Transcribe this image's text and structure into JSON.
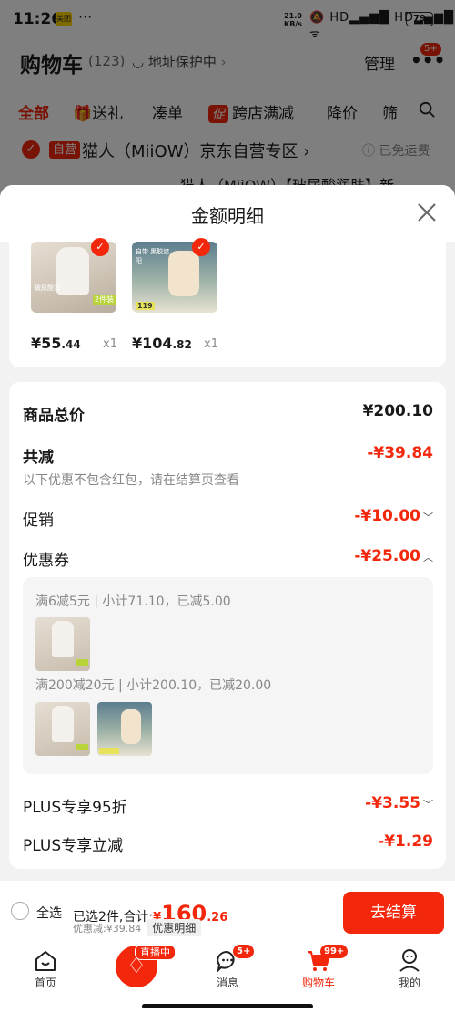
{
  "status_bar": {
    "time": "11:26",
    "app_badge": "美团",
    "more": "···",
    "net_speed_value": "21.0",
    "net_speed_unit": "KB/s",
    "signal_icons": "🔕 HD▂▄▆█ HD▂▄▆█ ᯤ",
    "battery": "79"
  },
  "cart_header": {
    "title": "购物车",
    "count": "(123)",
    "address_guard": "地址保护中",
    "manage": "管理",
    "message_badge": "5+"
  },
  "filter_tabs": {
    "all": "全部",
    "gift": "送礼",
    "bundle": "凑单",
    "promo_tag": "促",
    "cross_store": "跨店满减",
    "price_drop": "降价",
    "filter": "筛"
  },
  "store_row": {
    "self_run_tag": "自营",
    "store_name": "猫人（MiiOW）京东自营专区",
    "free_shipping": "已免运费"
  },
  "product_peek": "猫人（MiiOW）【玻尿酸润肤】新",
  "sheet": {
    "title": "金额明细",
    "items": [
      {
        "img_text_a": "玻尿酸润",
        "img_text_b": "2件装",
        "price_int": "¥55",
        "price_dec": ".44",
        "qty": "x1"
      },
      {
        "img_text_a": "自带 黑胶遮阳",
        "img_text_b": "119",
        "price_int": "¥104",
        "price_dec": ".82",
        "qty": "x1"
      }
    ],
    "total_label": "商品总价",
    "total_value": "¥200.10",
    "reduced_label": "共减",
    "reduced_value": "-¥39.84",
    "reduced_note": "以下优惠不包含红包，请在结算页查看",
    "promo_label": "促销",
    "promo_value": "-¥10.00",
    "coupon_label": "优惠券",
    "coupon_value": "-¥25.00",
    "coupon_rules": [
      "满6减5元 | 小计71.10，已减5.00",
      "满200减20元 | 小计200.10，已减20.00"
    ],
    "plus95_label": "PLUS专享95折",
    "plus95_value": "-¥3.55",
    "plus_instant_label": "PLUS专享立减",
    "plus_instant_value": "-¥1.29"
  },
  "checkout": {
    "select_all": "全选",
    "selected_prefix": "已选2件,合计:",
    "total_currency": "¥",
    "total_int": "160",
    "total_dec": ".26",
    "discount_line": "优惠减:¥39.84",
    "detail_chip": "优惠明细",
    "button": "去结算"
  },
  "bottom_nav": {
    "home": "首页",
    "live_badge": "直播中",
    "messages": "消息",
    "messages_badge": "5+",
    "cart": "购物车",
    "cart_badge": "99+",
    "mine": "我的"
  },
  "colors": {
    "accent_red": "#f2270c"
  }
}
